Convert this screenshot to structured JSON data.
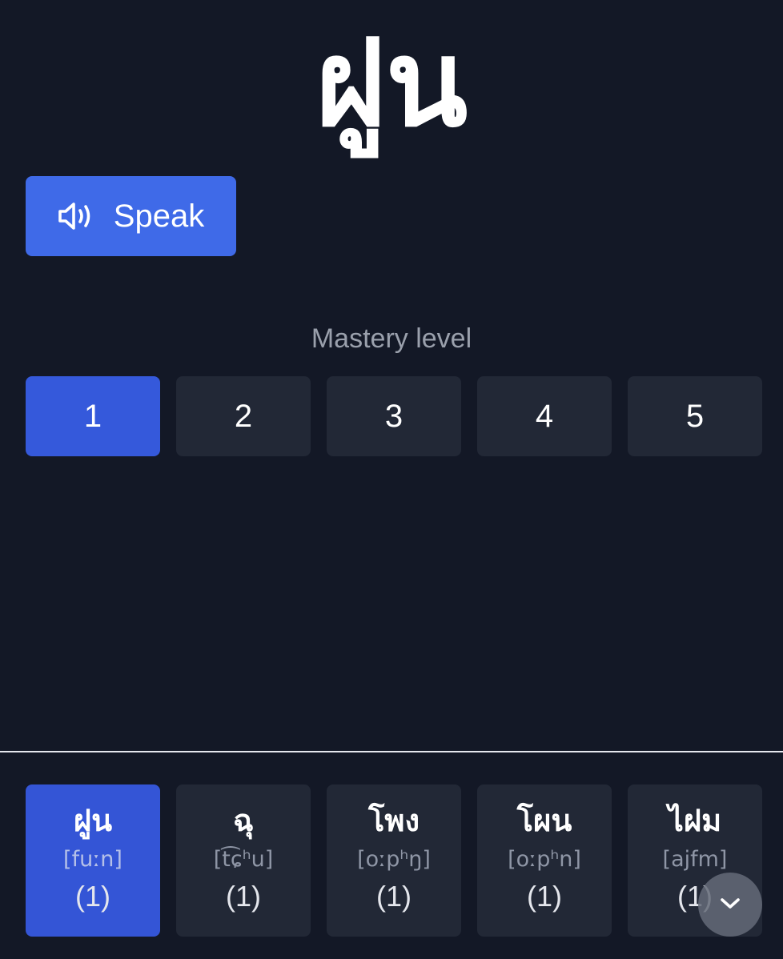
{
  "word": {
    "thai": "ฝูน"
  },
  "speak_button": {
    "label": "Speak",
    "icon": "speaker-icon"
  },
  "mastery": {
    "label": "Mastery level",
    "levels": [
      "1",
      "2",
      "3",
      "4",
      "5"
    ],
    "selected": "1"
  },
  "word_list": [
    {
      "thai": "ฝูน",
      "ipa": "[fuːn]",
      "count": "(1)",
      "selected": true
    },
    {
      "thai": "ฉุ",
      "ipa": "[t͡ɕʰu]",
      "count": "(1)",
      "selected": false
    },
    {
      "thai": "โพง",
      "ipa": "[oːpʰŋ]",
      "count": "(1)",
      "selected": false
    },
    {
      "thai": "โผน",
      "ipa": "[oːpʰn]",
      "count": "(1)",
      "selected": false
    },
    {
      "thai": "ไฝม",
      "ipa": "[ajfm]",
      "count": "(1)",
      "selected": false
    }
  ],
  "scroll_button": {
    "icon": "chevron-down-icon"
  },
  "colors": {
    "background": "#131826",
    "accent": "#3f6ae8",
    "selected_level": "#3559db",
    "tile": "#222836"
  }
}
